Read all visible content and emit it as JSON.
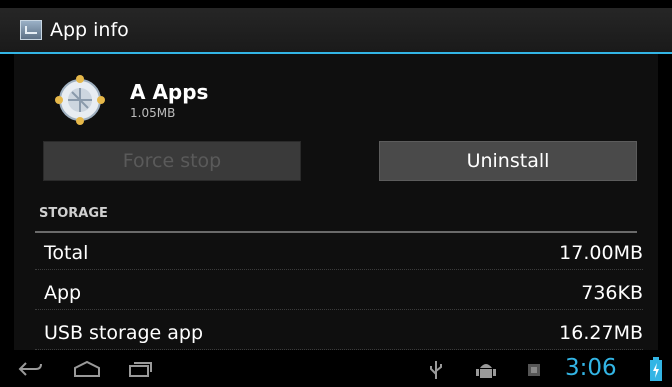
{
  "actionbar": {
    "title": "App info"
  },
  "app": {
    "name": "A Apps",
    "size": "1.05MB"
  },
  "buttons": {
    "force_stop": "Force stop",
    "uninstall": "Uninstall"
  },
  "storage": {
    "header": "STORAGE",
    "rows": [
      {
        "label": "Total",
        "value": "17.00MB"
      },
      {
        "label": "App",
        "value": "736KB"
      },
      {
        "label": "USB storage app",
        "value": "16.27MB"
      }
    ]
  },
  "statusbar": {
    "time": "3:06"
  },
  "colors": {
    "accent": "#33b5e5",
    "background": "#000000",
    "button": "#4a4a4a"
  },
  "icons": [
    "back-icon",
    "home-icon",
    "recent-apps-icon",
    "usb-icon",
    "android-debug-icon",
    "notification-icon",
    "battery-icon"
  ]
}
